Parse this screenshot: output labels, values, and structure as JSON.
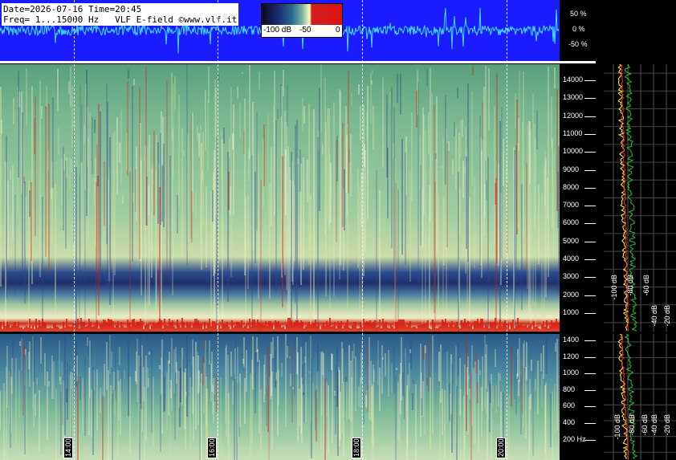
{
  "header": {
    "line1": "Date=2026-07-16 Time=20:45",
    "line2": "Freq= 1...15000 Hz   VLF E-field ©www.vlf.it"
  },
  "colorbar": {
    "labels": [
      "-100 dB",
      "-50",
      "0"
    ]
  },
  "waveform": {
    "percent_labels": [
      "50 %",
      "0 %",
      "-50 %"
    ]
  },
  "upper_axis": {
    "freq_labels": [
      "14000",
      "13000",
      "12000",
      "11000",
      "10000",
      "9000",
      "8000",
      "7000",
      "6000",
      "5000",
      "4000",
      "3000",
      "2000",
      "1000"
    ]
  },
  "lower_axis": {
    "freq_labels": [
      "1400",
      "1200",
      "1000",
      "800",
      "600",
      "400",
      "200 Hz"
    ]
  },
  "db_labels": {
    "upper": [
      "-100 dB",
      "-80 dB",
      "-60 dB",
      "-40 dB",
      "-20 dB"
    ],
    "lower": [
      "-100 dB",
      "-80 dB",
      "-60 dB",
      "-40 dB",
      "-20 dB"
    ]
  },
  "time_labels": [
    "14:00",
    "16:00",
    "18:00",
    "20:00"
  ],
  "colors": {
    "waveform_bg": "#1b1bff",
    "waveform_trace": "#40e0ff",
    "spectrum_yellow": "#ffff40",
    "spectrum_green": "#30c030",
    "spectrum_red": "#ff3030"
  }
}
